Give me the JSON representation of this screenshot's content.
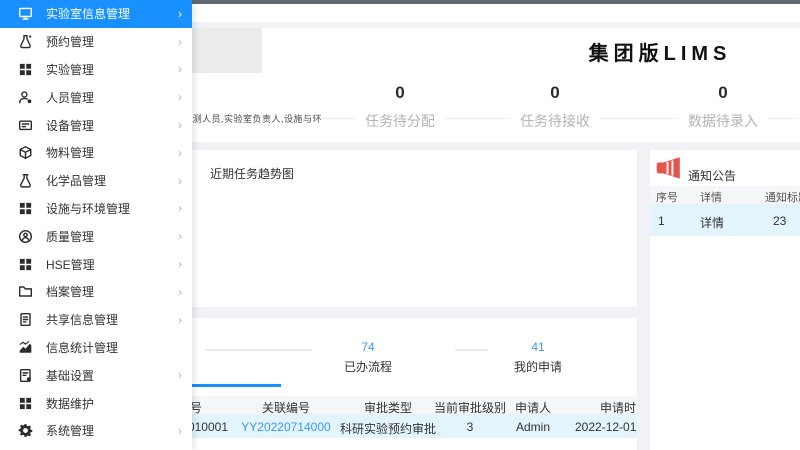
{
  "brand_title": "集团版LIMS",
  "marquee_text": "检测人员,实验室负责人,设施与环",
  "stats": [
    {
      "value": "0",
      "label": "任务待分配"
    },
    {
      "value": "0",
      "label": "任务待接收"
    },
    {
      "value": "0",
      "label": "数据待录入"
    }
  ],
  "trend_card": {
    "title": "近期任务趋势图"
  },
  "notice_card": {
    "title": "通知公告",
    "columns": [
      "序号",
      "详情",
      "通知标题"
    ],
    "rows": [
      {
        "index": "1",
        "detail_link": "详情",
        "title": "23"
      }
    ]
  },
  "workflow_card": {
    "tabs": [
      {
        "count": "74",
        "label": "已办流程"
      },
      {
        "count": "41",
        "label": "我的申请"
      }
    ],
    "columns": [
      "审批编号",
      "关联编号",
      "审批类型",
      "当前审批级别",
      "申请人",
      "申请时间"
    ],
    "rows": [
      {
        "approval_no": "010001",
        "related_no": "YY20220714000",
        "approval_type": "科研实验预约审批",
        "level": "3",
        "applicant": "Admin",
        "apply_time": "2022-12-01"
      }
    ]
  },
  "sidebar": {
    "items": [
      {
        "label": "实验室信息管理",
        "icon": "monitor-icon",
        "active": true,
        "has_children": true
      },
      {
        "label": "预约管理",
        "icon": "flask-star-icon",
        "active": false,
        "has_children": true
      },
      {
        "label": "实验管理",
        "icon": "grid-icon",
        "active": false,
        "has_children": true
      },
      {
        "label": "人员管理",
        "icon": "user-gear-icon",
        "active": false,
        "has_children": true
      },
      {
        "label": "设备管理",
        "icon": "device-icon",
        "active": false,
        "has_children": true
      },
      {
        "label": "物料管理",
        "icon": "cube-icon",
        "active": false,
        "has_children": true
      },
      {
        "label": "化学品管理",
        "icon": "beaker-icon",
        "active": false,
        "has_children": true
      },
      {
        "label": "设施与环境管理",
        "icon": "grid-icon",
        "active": false,
        "has_children": true
      },
      {
        "label": "质量管理",
        "icon": "badge-icon",
        "active": false,
        "has_children": true
      },
      {
        "label": "HSE管理",
        "icon": "grid-icon",
        "active": false,
        "has_children": true
      },
      {
        "label": "档案管理",
        "icon": "folder-icon",
        "active": false,
        "has_children": true
      },
      {
        "label": "共享信息管理",
        "icon": "document-icon",
        "active": false,
        "has_children": true
      },
      {
        "label": "信息统计管理",
        "icon": "chart-icon",
        "active": false,
        "has_children": false
      },
      {
        "label": "基础设置",
        "icon": "doc-gear-icon",
        "active": false,
        "has_children": true
      },
      {
        "label": "数据维护",
        "icon": "grid-icon",
        "active": false,
        "has_children": false
      },
      {
        "label": "系统管理",
        "icon": "gear-icon",
        "active": false,
        "has_children": true
      }
    ]
  },
  "colors": {
    "accent": "#1890ff",
    "link": "#3a9af0",
    "notice_icon": "#e8544e",
    "row_highlight": "#e4f4fd",
    "table_header_bg": "#f5f6f8",
    "page_bg": "#f0f2f5",
    "topbar": "#63686d"
  }
}
